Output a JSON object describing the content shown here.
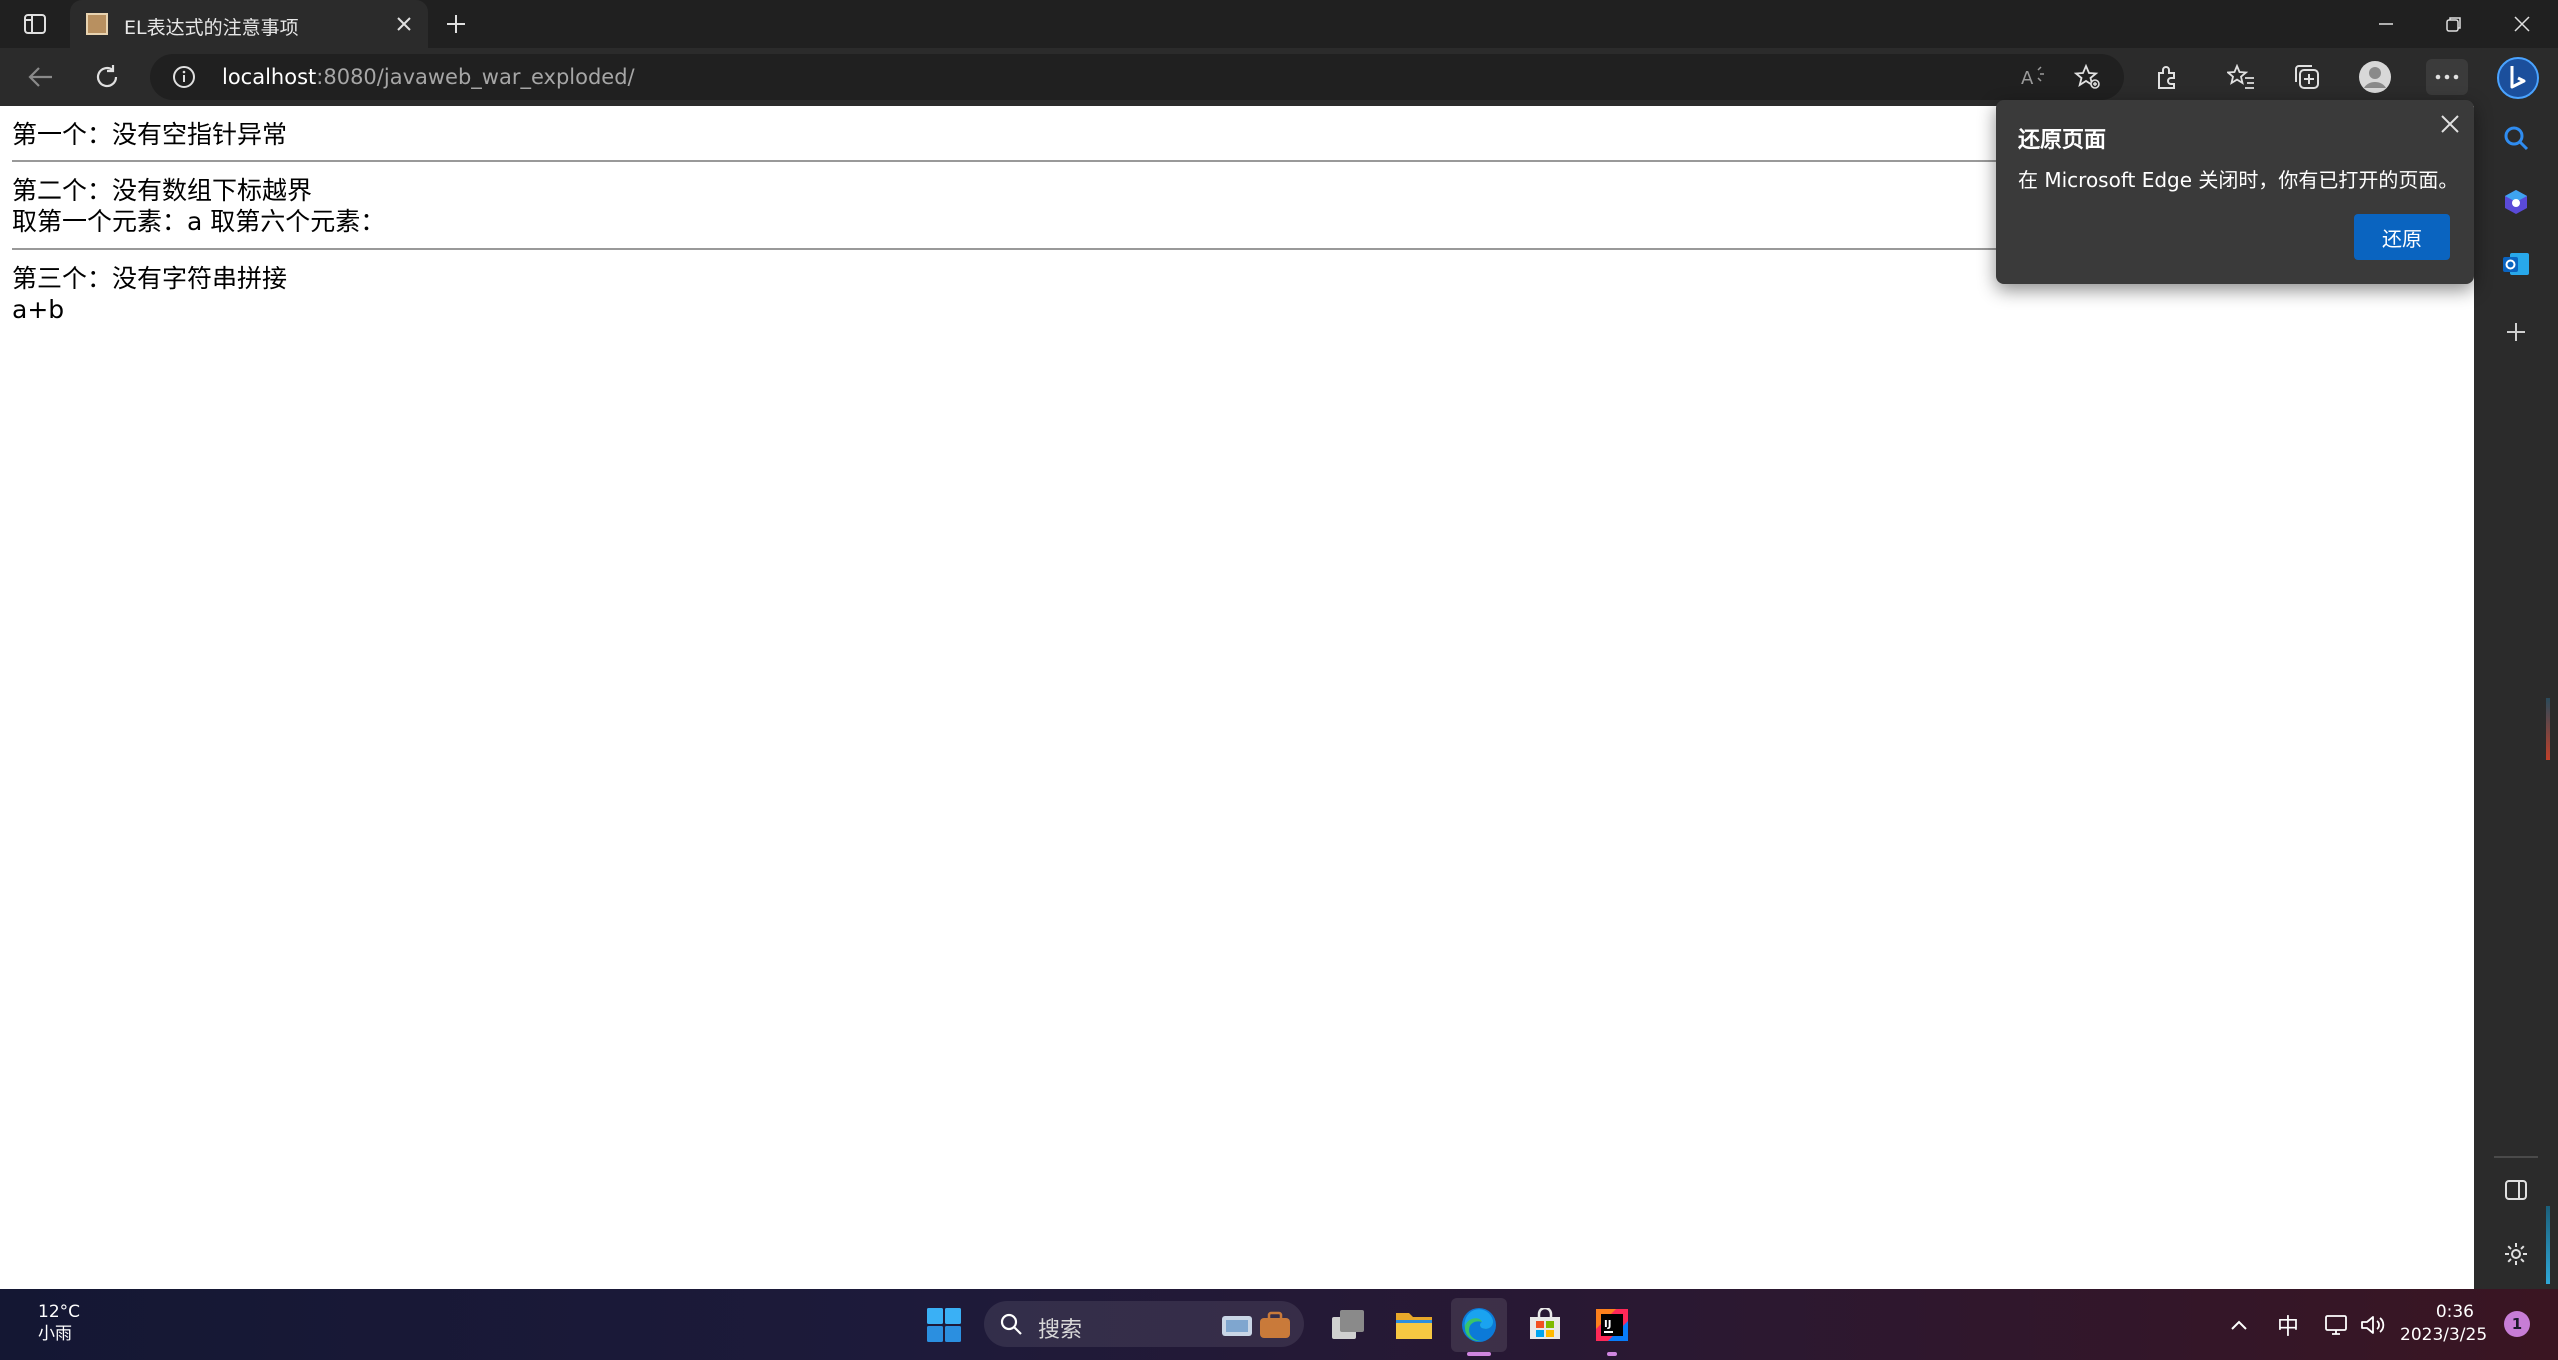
{
  "browser": {
    "tab_title": "EL表达式的注意事项",
    "url_host": "localhost",
    "url_rest": ":8080/javaweb_war_exploded/"
  },
  "content": {
    "line1": "第一个：没有空指针异常",
    "line2": "第二个：没有数组下标越界",
    "line3": "取第一个元素：a 取第六个元素：",
    "line4": "第三个：没有字符串拼接",
    "line5": "a+b"
  },
  "popup": {
    "title": "还原页面",
    "message": "在 Microsoft Edge 关闭时，你有已打开的页面。",
    "button": "还原"
  },
  "taskbar": {
    "temperature": "12°C",
    "weather": "小雨",
    "search_placeholder": "搜索",
    "ime": "中",
    "time": "0:36",
    "date": "2023/3/25",
    "notification_count": "1"
  },
  "colors": {
    "accent": "#0a64c0",
    "titlebar": "#202020",
    "toolbar": "#2b2b2b"
  }
}
